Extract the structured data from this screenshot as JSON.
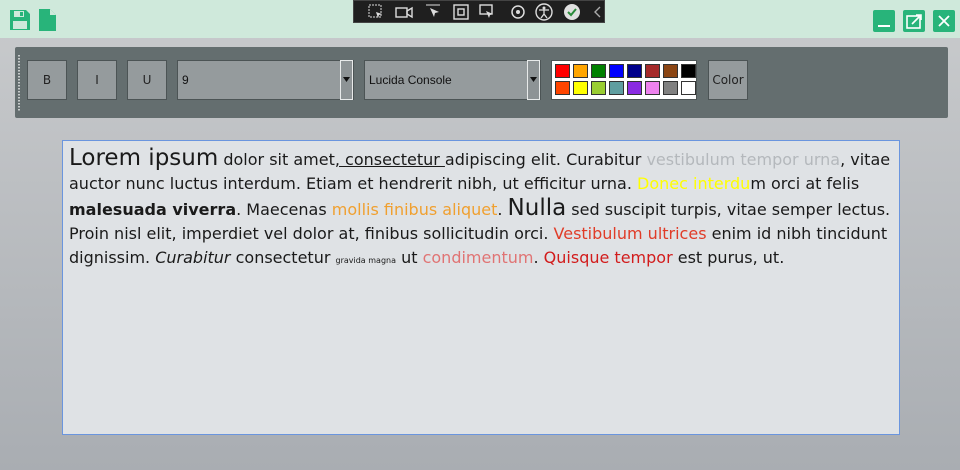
{
  "titlebar": {
    "left_icons": [
      "save-icon",
      "new-document-icon"
    ],
    "window_buttons": [
      "minimize-icon",
      "restore-icon",
      "close-icon"
    ],
    "background": "#cfe9db",
    "accent": "#28b47a"
  },
  "debug_toolbar": {
    "icons": [
      "select-element-icon",
      "video-icon",
      "pointer-select-icon",
      "select-box-icon",
      "display-layout-icon",
      "hot-reload-icon",
      "accessibility-icon",
      "checkmark-icon",
      "collapse-chevron-icon"
    ]
  },
  "toolbar": {
    "bold_label": "B",
    "italic_label": "I",
    "underline_label": "U",
    "font_size": "9",
    "font_family": "Lucida Console",
    "color_label": "Color",
    "palette_row1": [
      "#ff0000",
      "#ffa500",
      "#008000",
      "#0000ff",
      "#00008b",
      "#a52a2a",
      "#8b4513",
      "#000000"
    ],
    "palette_row2": [
      "#ff4500",
      "#ffff00",
      "#9acd32",
      "#5f9ea0",
      "#8a2be2",
      "#ee82ee",
      "#808080",
      "#ffffff"
    ]
  },
  "editor": {
    "runs": {
      "r1": "Lorem ipsum",
      "r2": " dolor sit amet",
      "r3": ", consectetur ",
      "r4": "adipiscing elit. Curabitur ",
      "r5": "vestibulum tempor urna",
      "r6": ", vitae auctor nunc luctus interdum. Etiam et hendrerit nibh, ut efficitur urna. ",
      "r7": "Donec interdu",
      "r8": "m orci at felis ",
      "r9": "malesuada viverra",
      "r10": ". Maecenas ",
      "r11": "mollis finibus aliquet",
      "r12": ". ",
      "r13": "Nulla",
      "r14": " sed suscipit turpis, vitae semper lectus. Proin nisl elit, imperdiet vel dolor at, finibus sollicitudin orci. ",
      "r15": "Vestibulum ultrices",
      "r16": " enim id nibh tincidunt dignissim. ",
      "r17": "Curabitur",
      "r18": " consectetur ",
      "r19": "gravida magna",
      "r20": " ut ",
      "r21": "condimentum",
      "r22": ". ",
      "r23": "Quisque tempor",
      "r24": " est purus, ut."
    }
  }
}
